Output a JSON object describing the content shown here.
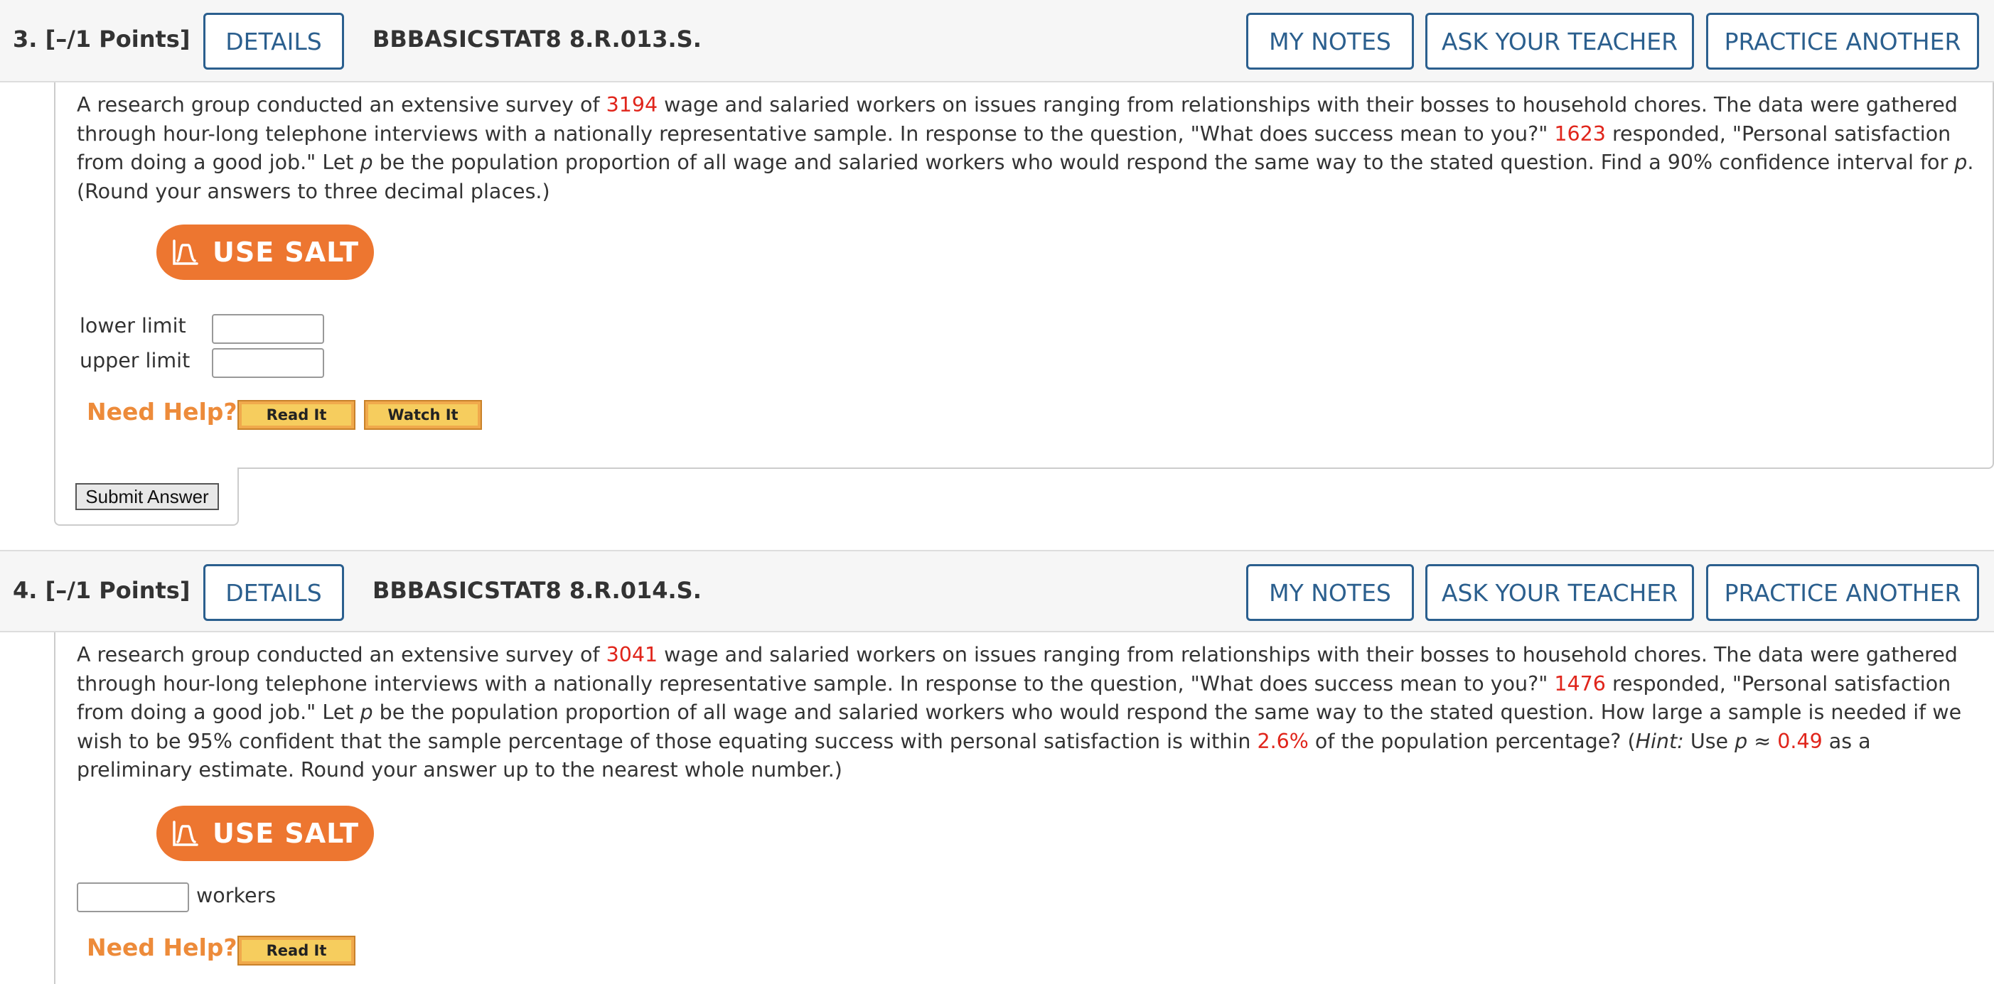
{
  "header_buttons": {
    "details": "DETAILS",
    "my_notes": "MY NOTES",
    "ask_teacher": "ASK YOUR TEACHER",
    "practice": "PRACTICE ANOTHER"
  },
  "q3": {
    "number_points": "3.  [–/1 Points]",
    "code": "BBBASICSTAT8 8.R.013.S.",
    "text": {
      "p1": "A research group conducted an extensive survey of ",
      "n_total": "3194",
      "p2": " wage and salaried workers on issues ranging from relationships with their bosses to household chores. The data were gathered through hour-long telephone interviews with a nationally representative sample. In response to the question, \"What does success mean to you?\" ",
      "n_resp": "1623",
      "p3": " responded, \"Personal satisfaction from doing a good job.\" Let ",
      "p_var": "p",
      "p4": " be the population proportion of all wage and salaried workers who would respond the same way to the stated question. Find a 90% confidence interval for ",
      "p_var2": "p",
      "p5": ". (Round your answers to three decimal places.)"
    },
    "salt_label": "USE SALT",
    "lower_label": "lower limit",
    "upper_label": "upper limit",
    "lower_value": "",
    "upper_value": "",
    "need_help": "Need Help?",
    "read_it": "Read It",
    "watch_it": "Watch It",
    "submit": "Submit Answer"
  },
  "q4": {
    "number_points": "4.  [–/1 Points]",
    "code": "BBBASICSTAT8 8.R.014.S.",
    "text": {
      "p1": "A research group conducted an extensive survey of ",
      "n_total": "3041",
      "p2": " wage and salaried workers on issues ranging from relationships with their bosses to household chores. The data were gathered through hour-long telephone interviews with a nationally representative sample. In response to the question, \"What does success mean to you?\" ",
      "n_resp": "1476",
      "p3": " responded, \"Personal satisfaction from doing a good job.\" Let ",
      "p_var": "p",
      "p4": " be the population proportion of all wage and salaried workers who would respond the same way to the stated question. How large a sample is needed if we wish to be 95% confident that the sample percentage of those equating success with personal satisfaction is within ",
      "margin": "2.6%",
      "p5": " of the population percentage? (",
      "hint": "Hint:",
      "p6": " Use ",
      "p_var2": "p",
      "p7": " ≈ ",
      "estimate": "0.49",
      "p8": " as a preliminary estimate. Round your answer up to the nearest whole number.)"
    },
    "salt_label": "USE SALT",
    "workers_value": "",
    "workers_label": "workers",
    "need_help": "Need Help?",
    "read_it": "Read It"
  },
  "colors": {
    "accent_blue": "#2b5f8e",
    "salt_orange": "#ed7630",
    "help_orange": "#ed8b3a",
    "value_red": "#e0251b"
  },
  "icons": {
    "salt": "salt-chart-icon"
  }
}
